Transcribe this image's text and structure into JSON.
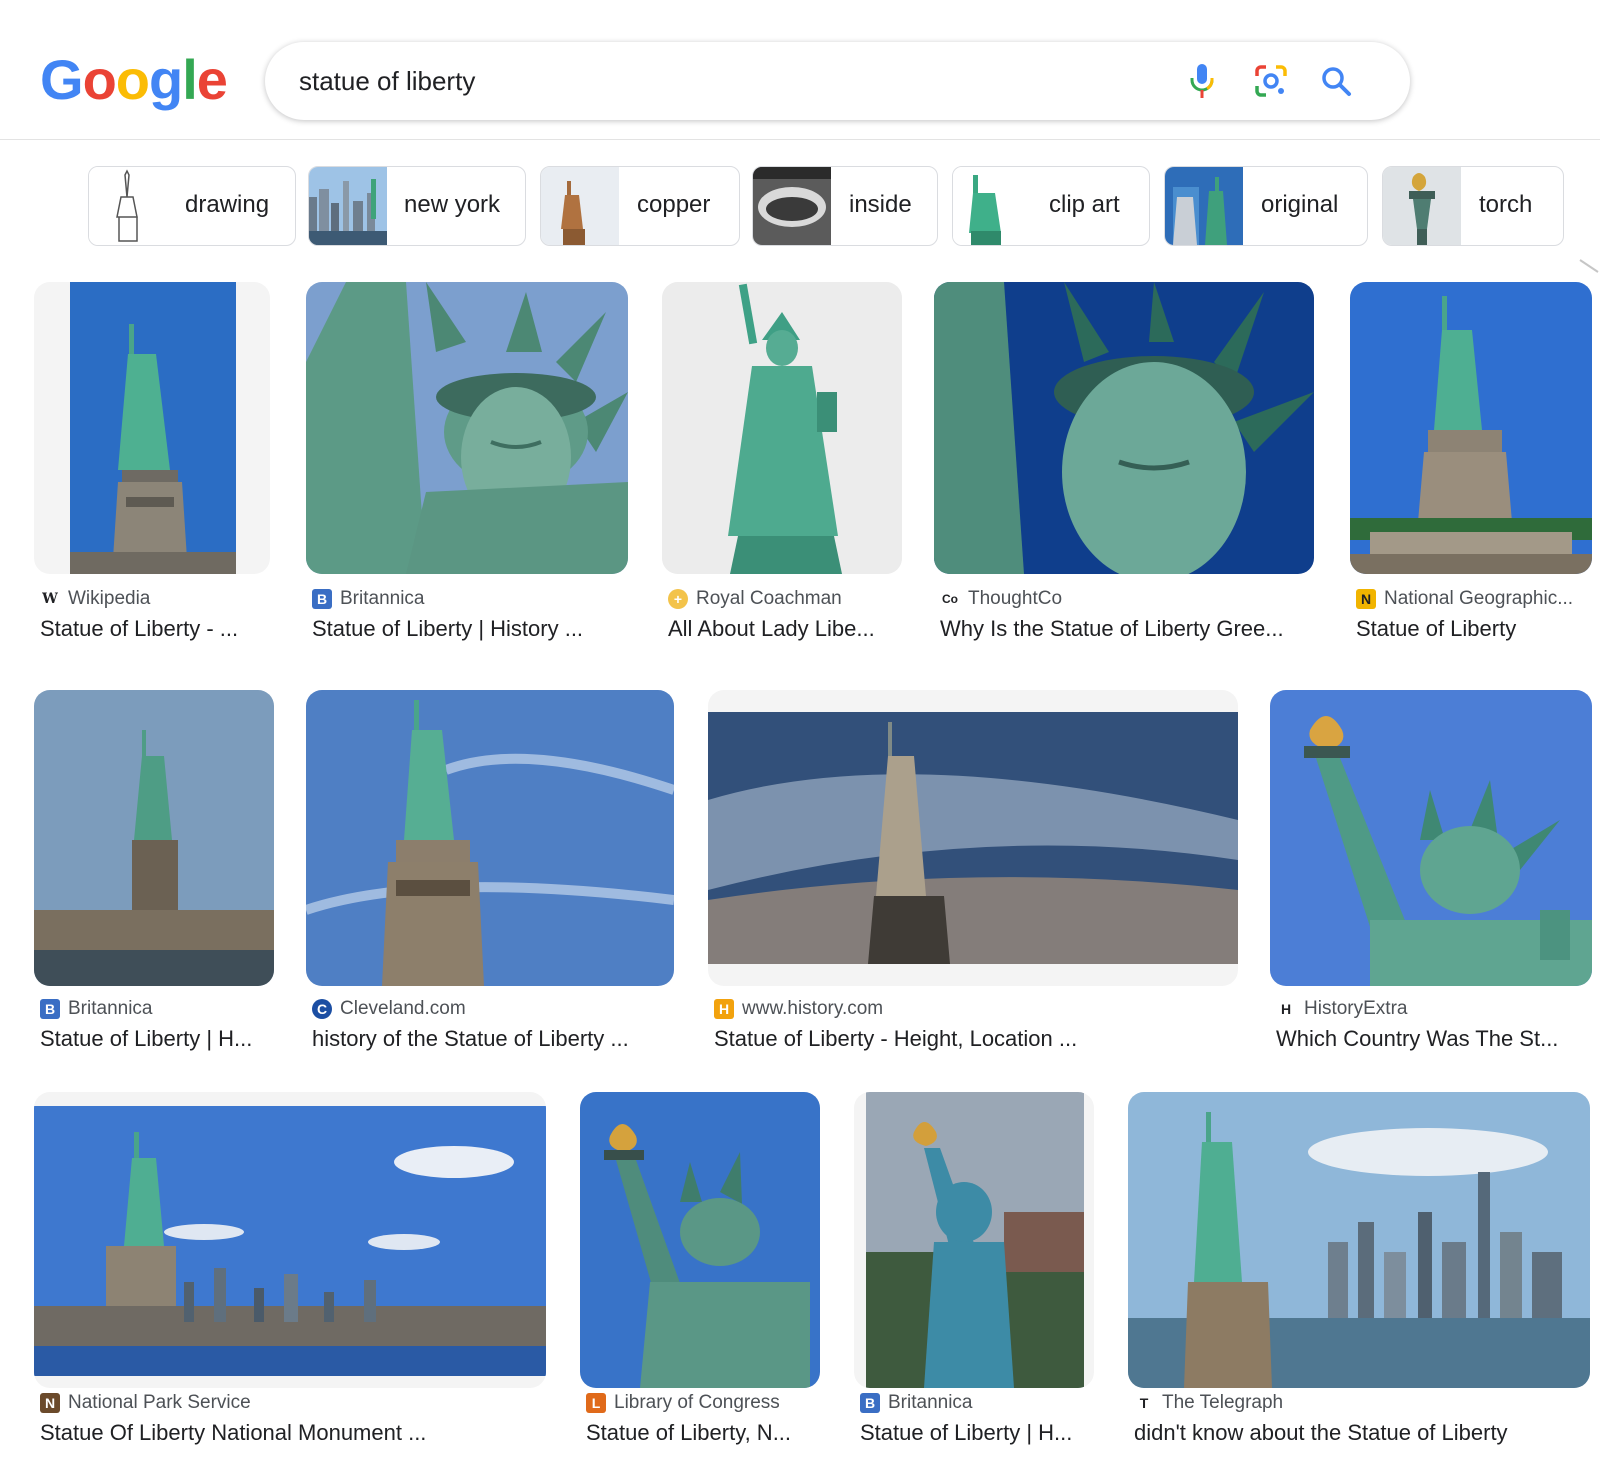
{
  "search": {
    "query": "statue of liberty",
    "logo_letters": [
      {
        "ch": "G",
        "color": "#4285F4"
      },
      {
        "ch": "o",
        "color": "#EA4335"
      },
      {
        "ch": "o",
        "color": "#FBBC05"
      },
      {
        "ch": "g",
        "color": "#4285F4"
      },
      {
        "ch": "l",
        "color": "#34A853"
      },
      {
        "ch": "e",
        "color": "#EA4335"
      }
    ]
  },
  "chips": [
    {
      "label": "drawing"
    },
    {
      "label": "new york"
    },
    {
      "label": "copper"
    },
    {
      "label": "inside"
    },
    {
      "label": "clip art"
    },
    {
      "label": "original"
    },
    {
      "label": "torch"
    }
  ],
  "results": [
    {
      "source": "Wikipedia",
      "title": "Statue of Liberty - ...",
      "favicon": "W"
    },
    {
      "source": "Britannica",
      "title": "Statue of Liberty | History ...",
      "favicon": "B"
    },
    {
      "source": "Royal Coachman",
      "title": "All About Lady Libe...",
      "favicon": "+"
    },
    {
      "source": "ThoughtCo",
      "title": "Why Is the Statue of Liberty Gree...",
      "favicon": "Co"
    },
    {
      "source": "National Geographic...",
      "title": "Statue of Liberty",
      "favicon": "N"
    },
    {
      "source": "Britannica",
      "title": "Statue of Liberty | H...",
      "favicon": "B"
    },
    {
      "source": "Cleveland.com",
      "title": "history of the Statue of Liberty ...",
      "favicon": "C"
    },
    {
      "source": "www.history.com",
      "title": "Statue of Liberty - Height, Location ...",
      "favicon": "H"
    },
    {
      "source": "HistoryExtra",
      "title": "Which Country Was The St...",
      "favicon": "H"
    },
    {
      "source": "National Park Service",
      "title": "Statue Of Liberty National Monument ...",
      "favicon": "N"
    },
    {
      "source": "Library of Congress",
      "title": "Statue of Liberty, N...",
      "favicon": "L"
    },
    {
      "source": "Britannica",
      "title": "Statue of Liberty | H...",
      "favicon": "B"
    },
    {
      "source": "The Telegraph",
      "title": "didn't know about the Statue of Liberty",
      "favicon": "T"
    }
  ]
}
